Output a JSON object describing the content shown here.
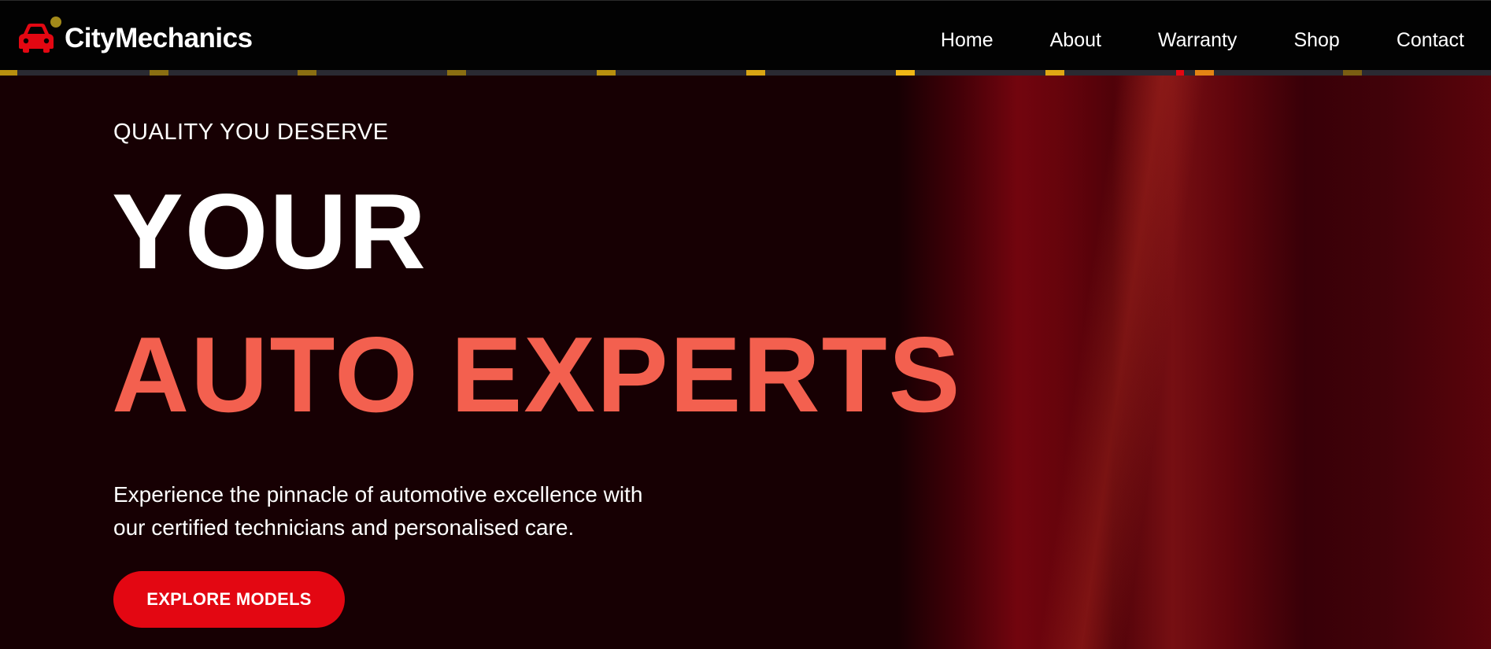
{
  "brand": {
    "name": "CityMechanics",
    "icon": "car-icon",
    "accent_color": "#e30712"
  },
  "nav": {
    "links": [
      {
        "label": "Home"
      },
      {
        "label": "About"
      },
      {
        "label": "Warranty"
      },
      {
        "label": "Shop"
      },
      {
        "label": "Contact"
      }
    ]
  },
  "hero": {
    "tagline": "QUALITY YOU DESERVE",
    "title_line1": "YOUR",
    "title_line2": "AUTO EXPERTS",
    "title_line2_color": "#f3604f",
    "description_line1": "Experience the pinnacle of automotive excellence with",
    "description_line2": "our certified technicians and personalised care.",
    "cta_label": "EXPLORE MODELS",
    "cta_color": "#e30712"
  }
}
